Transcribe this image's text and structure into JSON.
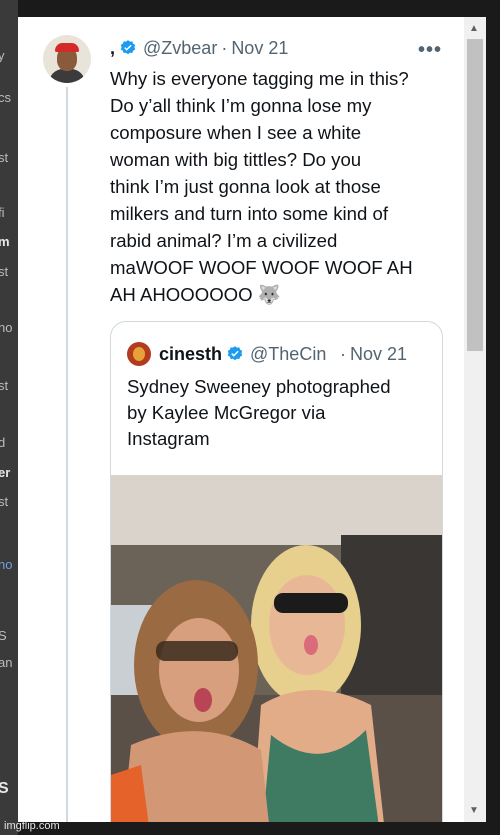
{
  "background_page": {
    "fragments": [
      "y",
      "cs",
      "st",
      "fi",
      "m",
      "st",
      "no",
      "st",
      "d",
      "er",
      "st",
      "no",
      "S",
      "an",
      "S"
    ]
  },
  "tweet": {
    "display_name": ",",
    "handle": "@Zvbear",
    "separator": "·",
    "date": "Nov 21",
    "more_label": "•••",
    "text": "Why is everyone tagging me in this?\nDo y’all think I’m gonna lose my\ncomposure when I see a white\nwoman with big tittles? Do you\nthink I’m just gonna look at those\nmilkers and turn into some kind of\nrabid animal? I’m a civilized\nmaWOOF WOOF WOOF WOOF AH\nAH AHOOOOOO 🐺",
    "verified_icon": "verified-badge-icon"
  },
  "quoted_tweet": {
    "display_name": "cinesth",
    "handle": "@TheCin",
    "separator": "·",
    "date": "Nov 21",
    "text": "Sydney Sweeney photographed\nby Kaylee McGregor via\nInstagram",
    "verified_icon": "verified-badge-icon",
    "media": "photo-two-women-selfie-in-car"
  },
  "scrollbar": {
    "up_icon": "▲",
    "down_icon": "▼"
  },
  "watermark": "imgflip.com",
  "colors": {
    "verified_blue": "#1d9bf0",
    "text_primary": "#0f1419",
    "text_secondary": "#536471",
    "border": "#cfd9de"
  }
}
